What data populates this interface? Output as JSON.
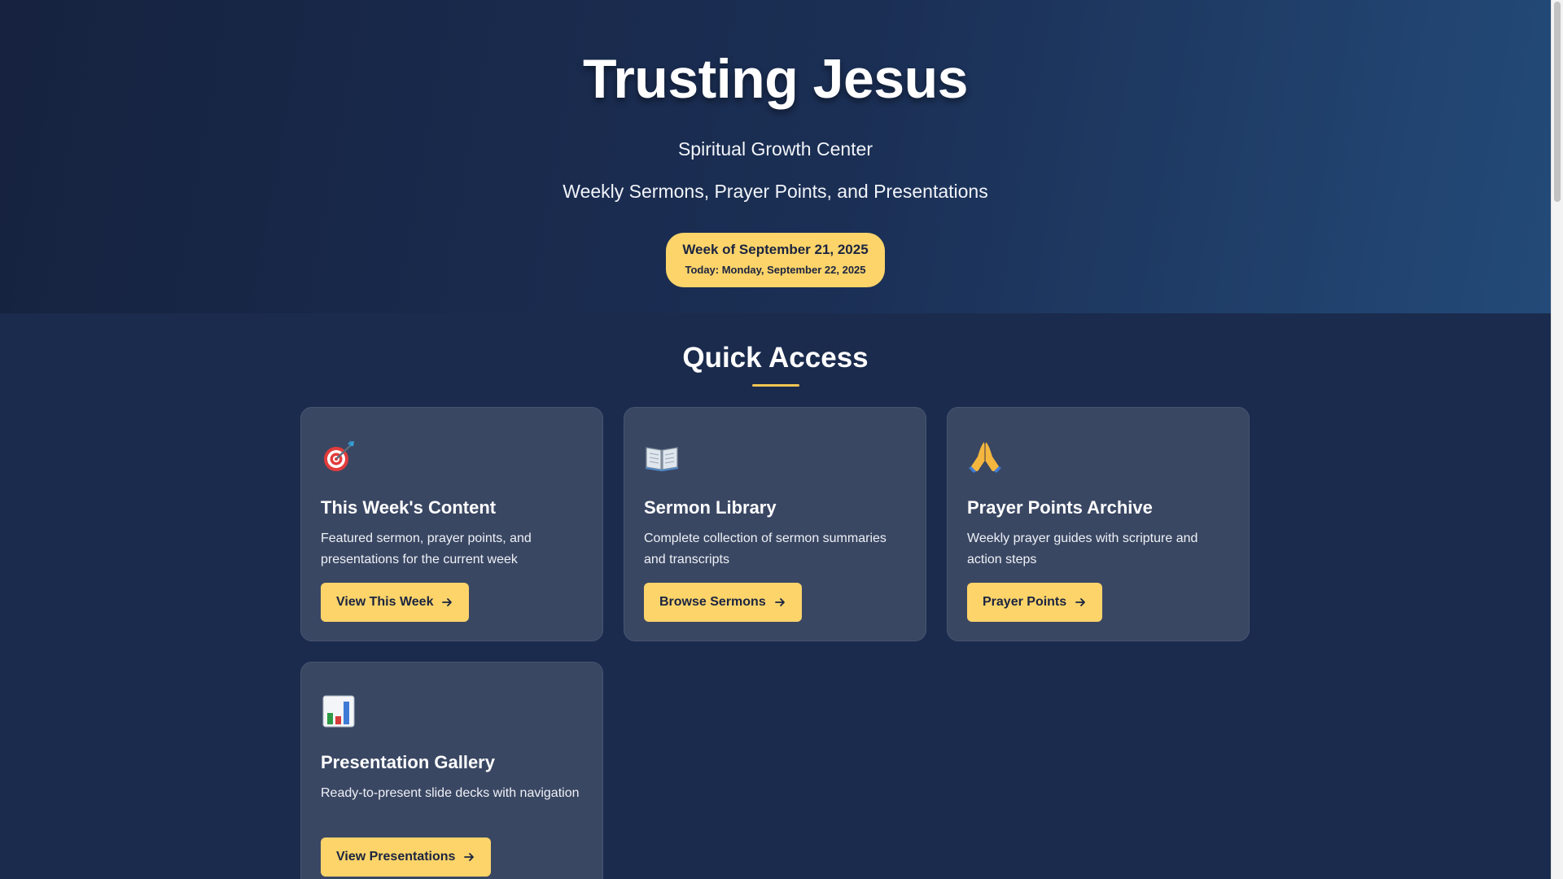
{
  "hero": {
    "title": "Trusting Jesus",
    "subtitle": "Spiritual Growth Center",
    "tagline": "Weekly Sermons, Prayer Points, and Presentations",
    "week_label": "Week of September 21, 2025",
    "today_label": "Today: Monday, September 22, 2025"
  },
  "quick_access": {
    "title": "Quick Access",
    "cards": [
      {
        "icon": "target-icon",
        "title": "This Week's Content",
        "description": "Featured sermon, prayer points, and presentations for the current week",
        "button": "View This Week"
      },
      {
        "icon": "open-book-icon",
        "title": "Sermon Library",
        "description": "Complete collection of sermon summaries and transcripts",
        "button": "Browse Sermons"
      },
      {
        "icon": "praying-hands-icon",
        "title": "Prayer Points Archive",
        "description": "Weekly prayer guides with scripture and action steps",
        "button": "Prayer Points"
      },
      {
        "icon": "bar-chart-icon",
        "title": "Presentation Gallery",
        "description": "Ready-to-present slide decks with navigation",
        "button": "View Presentations"
      }
    ]
  },
  "colors": {
    "accent": "#fcd46a",
    "card_background": "#3a4763",
    "page_background": "#1b2b4d"
  }
}
